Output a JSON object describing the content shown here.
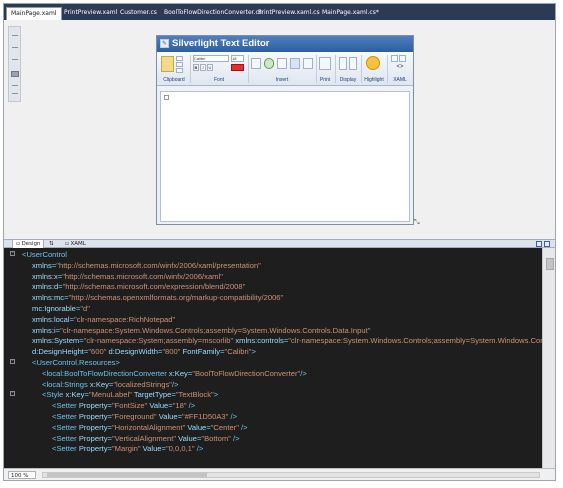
{
  "tabs": [
    {
      "label": "MainPage.xaml",
      "active": true
    },
    {
      "label": "PrintPreview.xaml",
      "active": false
    },
    {
      "label": "Customer.cs",
      "active": false
    },
    {
      "label": "BoolToFlowDirectionConverter.cs",
      "active": false
    },
    {
      "label": "PrintPreview.xaml.cs",
      "active": false
    },
    {
      "label": "MainPage.xaml.cs*",
      "active": false
    }
  ],
  "app": {
    "title": "Silverlight Text Editor",
    "font_name": "Calibri",
    "font_size": "18",
    "groups": {
      "clipboard": "Clipboard",
      "font": "Font",
      "insert": "Insert",
      "print": "Print",
      "display": "Display",
      "highlight": "Highlight",
      "xaml": "XAML"
    },
    "bold_label": "B",
    "italic_label": "I",
    "underline_label": "U",
    "xaml_glyph": "<>"
  },
  "split": {
    "design_label": "Design",
    "swap_label": "⇅",
    "xaml_label": "XAML"
  },
  "code_lines": [
    [
      [
        "p",
        "<"
      ],
      [
        "t",
        "UserControl"
      ]
    ],
    [
      [
        "a",
        "xmlns"
      ],
      [
        "p",
        "="
      ],
      [
        "v",
        "\"http://schemas.microsoft.com/winfx/2006/xaml/presentation\""
      ]
    ],
    [
      [
        "a",
        "xmlns:x"
      ],
      [
        "p",
        "="
      ],
      [
        "v",
        "\"http://schemas.microsoft.com/winfx/2006/xaml\""
      ]
    ],
    [
      [
        "a",
        "xmlns:d"
      ],
      [
        "p",
        "="
      ],
      [
        "v",
        "\"http://schemas.microsoft.com/expression/blend/2008\""
      ]
    ],
    [
      [
        "a",
        "xmlns:mc"
      ],
      [
        "p",
        "="
      ],
      [
        "v",
        "\"http://schemas.openxmlformats.org/markup-compatibility/2006\""
      ]
    ],
    [
      [
        "a",
        "mc:Ignorable"
      ],
      [
        "p",
        "="
      ],
      [
        "v",
        "\"d\""
      ]
    ],
    [
      [
        "a",
        "xmlns:local"
      ],
      [
        "p",
        "="
      ],
      [
        "v",
        "\"clr-namespace:RichNotepad\""
      ]
    ],
    [
      [
        "a",
        "xmlns:i"
      ],
      [
        "p",
        "="
      ],
      [
        "v",
        "\"clr-namespace:System.Windows.Controls;assembly=System.Windows.Controls.Data.Input\""
      ]
    ],
    [
      [
        "a",
        "xmlns:System"
      ],
      [
        "p",
        "="
      ],
      [
        "v",
        "\"clr-namespace:System;assembly=mscorlib\""
      ],
      [
        "a",
        " xmlns:controls"
      ],
      [
        "p",
        "="
      ],
      [
        "v",
        "\"clr-namespace:System.Windows.Controls;assembly=System.Windows.Controls\""
      ]
    ],
    [
      [
        "a",
        "d:DesignHeight"
      ],
      [
        "p",
        "="
      ],
      [
        "v",
        "\"600\""
      ],
      [
        "a",
        " d:DesignWidth"
      ],
      [
        "p",
        "="
      ],
      [
        "v",
        "\"800\""
      ],
      [
        "a",
        " FontFamily"
      ],
      [
        "p",
        "="
      ],
      [
        "v",
        "\"Calibri\""
      ],
      [
        "p",
        ">"
      ]
    ],
    [
      [
        "p",
        "<"
      ],
      [
        "t",
        "UserControl.Resources"
      ],
      [
        "p",
        ">"
      ]
    ],
    [
      [
        "p",
        "<"
      ],
      [
        "t",
        "local:BoolToFlowDirectionConverter"
      ],
      [
        "a",
        " x:Key"
      ],
      [
        "p",
        "="
      ],
      [
        "v",
        "\"BoolToFlowDirectionConverter\""
      ],
      [
        "p",
        "/>"
      ]
    ],
    [
      [
        "p",
        "<"
      ],
      [
        "t",
        "local:Strings"
      ],
      [
        "a",
        " x:Key"
      ],
      [
        "p",
        "="
      ],
      [
        "v",
        "\"localizedStrings\""
      ],
      [
        "p",
        "/>"
      ]
    ],
    [
      [
        "p",
        "<"
      ],
      [
        "t",
        "Style"
      ],
      [
        "a",
        " x:Key"
      ],
      [
        "p",
        "="
      ],
      [
        "v",
        "\"MenuLabel\""
      ],
      [
        "a",
        " TargetType"
      ],
      [
        "p",
        "="
      ],
      [
        "v",
        "\"TextBlock\""
      ],
      [
        "p",
        ">"
      ]
    ],
    [
      [
        "p",
        "<"
      ],
      [
        "t",
        "Setter"
      ],
      [
        "a",
        " Property"
      ],
      [
        "p",
        "="
      ],
      [
        "v",
        "\"FontSize\""
      ],
      [
        "a",
        " Value"
      ],
      [
        "p",
        "="
      ],
      [
        "v",
        "\"18\""
      ],
      [
        "p",
        " />"
      ]
    ],
    [
      [
        "p",
        "<"
      ],
      [
        "t",
        "Setter"
      ],
      [
        "a",
        " Property"
      ],
      [
        "p",
        "="
      ],
      [
        "v",
        "\"Foreground\""
      ],
      [
        "a",
        " Value"
      ],
      [
        "p",
        "="
      ],
      [
        "v",
        "\"#FF1D50A3\""
      ],
      [
        "p",
        " />"
      ]
    ],
    [
      [
        "p",
        "<"
      ],
      [
        "t",
        "Setter"
      ],
      [
        "a",
        " Property"
      ],
      [
        "p",
        "="
      ],
      [
        "v",
        "\"HorizontalAlignment\""
      ],
      [
        "a",
        " Value"
      ],
      [
        "p",
        "="
      ],
      [
        "v",
        "\"Center\""
      ],
      [
        "p",
        " />"
      ]
    ],
    [
      [
        "p",
        "<"
      ],
      [
        "t",
        "Setter"
      ],
      [
        "a",
        " Property"
      ],
      [
        "p",
        "="
      ],
      [
        "v",
        "\"VerticalAlignment\""
      ],
      [
        "a",
        " Value"
      ],
      [
        "p",
        "="
      ],
      [
        "v",
        "\"Bottom\""
      ],
      [
        "p",
        " />"
      ]
    ],
    [
      [
        "p",
        "<"
      ],
      [
        "t",
        "Setter"
      ],
      [
        "a",
        " Property"
      ],
      [
        "p",
        "="
      ],
      [
        "v",
        "\"Margin\""
      ],
      [
        "a",
        " Value"
      ],
      [
        "p",
        "="
      ],
      [
        "v",
        "\"0,0,0,1\""
      ],
      [
        "p",
        " />"
      ]
    ]
  ],
  "status": {
    "zoom": "100 %"
  },
  "colors": {
    "tabbar": "#2b3a55",
    "editor_bg": "#1e1e1e",
    "tag": "#6fc3e8",
    "attr": "#9cdcfe",
    "value": "#ce9178"
  }
}
